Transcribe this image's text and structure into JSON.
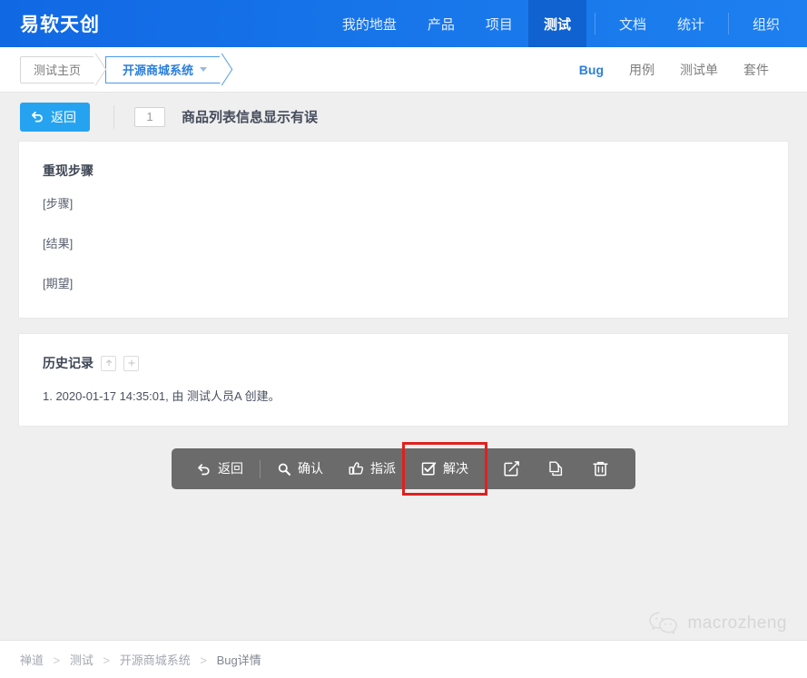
{
  "theme": {
    "primary": "#1877ea",
    "active_nav_bg": "#0f62cf",
    "link_blue": "#2b7fdb",
    "button_blue": "#25a3f0",
    "toolbar_gray": "#6b6b6b",
    "highlight_red": "#e02020",
    "page_bg": "#efefef"
  },
  "topbar": {
    "brand": "易软天创",
    "nav": [
      {
        "label": "我的地盘",
        "active": false
      },
      {
        "label": "产品",
        "active": false
      },
      {
        "label": "项目",
        "active": false
      },
      {
        "label": "测试",
        "active": true
      },
      {
        "label": "文档",
        "active": false
      },
      {
        "label": "统计",
        "active": false
      },
      {
        "label": "组织",
        "active": false
      }
    ]
  },
  "breadcrumb": {
    "items": [
      {
        "label": "测试主页",
        "current": false
      },
      {
        "label": "开源商城系统",
        "current": true,
        "has_dropdown": true
      }
    ]
  },
  "subtabs": [
    {
      "label": "Bug",
      "active": true
    },
    {
      "label": "用例",
      "active": false
    },
    {
      "label": "测试单",
      "active": false
    },
    {
      "label": "套件",
      "active": false
    }
  ],
  "titlerow": {
    "back_label": "返回",
    "back_icon": "back-arrow-icon",
    "bug_id": "1",
    "bug_title": "商品列表信息显示有误"
  },
  "steps_panel": {
    "heading": "重现步骤",
    "lines": [
      "[步骤]",
      "[结果]",
      "[期望]"
    ]
  },
  "history_panel": {
    "heading": "历史记录",
    "collapse_icon": "up-arrow-icon",
    "expand_icon": "plus-icon",
    "entries": [
      {
        "index": "1.",
        "timestamp": "2020-01-17 14:35:01",
        "by_label": "由",
        "actor": "测试人员A",
        "action": "创建。"
      }
    ],
    "entry_text": "1. 2020-01-17 14:35:01, 由 测试人员A 创建。"
  },
  "actionbar": {
    "buttons": [
      {
        "label": "返回",
        "icon": "back-arrow-icon",
        "highlighted": false,
        "icon_only": false
      },
      {
        "label": "确认",
        "icon": "magnifier-icon",
        "highlighted": false,
        "icon_only": false
      },
      {
        "label": "指派",
        "icon": "thumbs-up-icon",
        "highlighted": false,
        "icon_only": false
      },
      {
        "label": "解决",
        "icon": "checkbox-checked-icon",
        "highlighted": true,
        "icon_only": false
      },
      {
        "label": "",
        "icon": "edit-icon",
        "highlighted": false,
        "icon_only": true
      },
      {
        "label": "",
        "icon": "copy-icon",
        "highlighted": false,
        "icon_only": true
      },
      {
        "label": "",
        "icon": "trash-icon",
        "highlighted": false,
        "icon_only": true
      }
    ]
  },
  "watermark": {
    "icon": "wechat-icon",
    "text": "macrozheng"
  },
  "footer": {
    "crumbs": [
      "禅道",
      "测试",
      "开源商城系统",
      "Bug详情"
    ],
    "separator": ">",
    "text": "禅道 > 测试 > 开源商城系统 > Bug详情"
  }
}
